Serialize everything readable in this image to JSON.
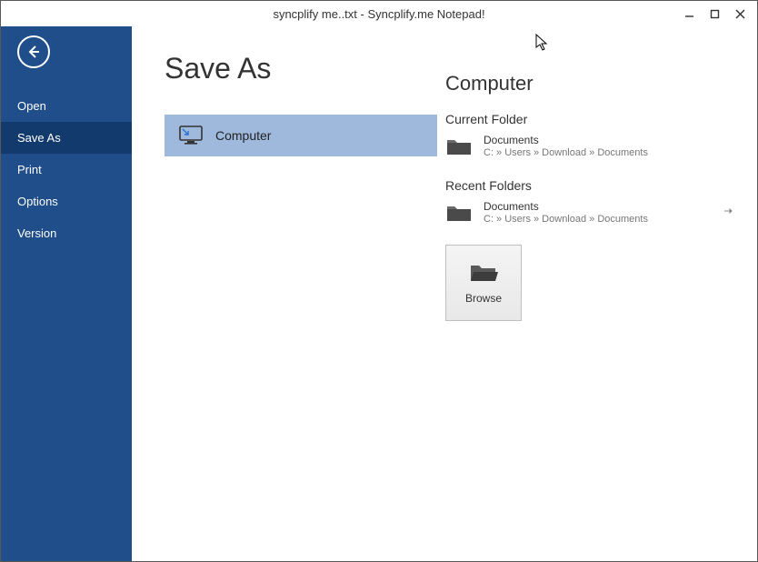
{
  "window": {
    "title": "syncplify me..txt - Syncplify.me Notepad!"
  },
  "sidebar": {
    "items": [
      {
        "label": "Open"
      },
      {
        "label": "Save As"
      },
      {
        "label": "Print"
      },
      {
        "label": "Options"
      },
      {
        "label": "Version"
      }
    ],
    "active_index": 1
  },
  "page": {
    "title": "Save As",
    "location_label": "Computer",
    "right_heading": "Computer",
    "current_folder_label": "Current Folder",
    "recent_folders_label": "Recent Folders",
    "current_folder": {
      "name": "Documents",
      "path": "C: » Users » Download » Documents"
    },
    "recent_folders": [
      {
        "name": "Documents",
        "path": "C: » Users » Download » Documents"
      }
    ],
    "browse_label": "Browse"
  }
}
